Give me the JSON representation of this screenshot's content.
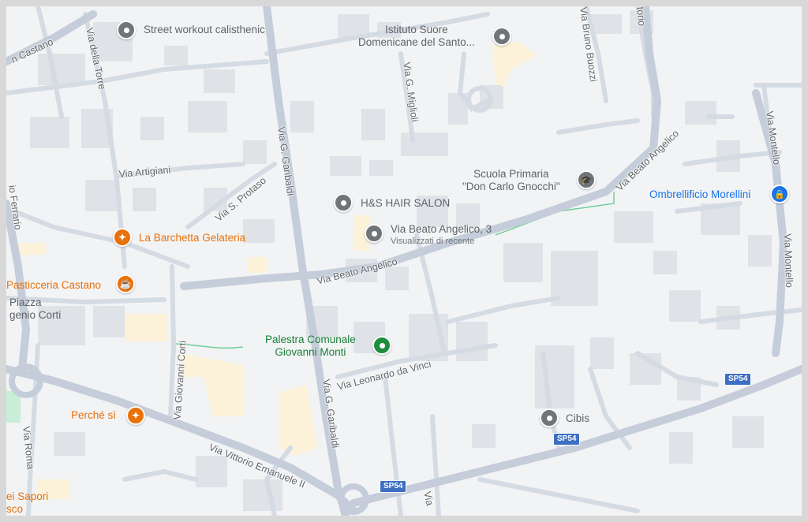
{
  "map": {
    "colors": {
      "background": "#f2f3f5",
      "block": "#dfe2e7",
      "road_major": "#c4cdd9",
      "road_minor": "#d5dbe3",
      "highlight_building": "#fbf2d9",
      "green": "#6fcf97",
      "poi_gray": "#70757a",
      "poi_orange": "#e8710a",
      "poi_green": "#1e8e3e",
      "poi_blue": "#1a73e8",
      "route_shield": "#3d6fc2"
    },
    "pois": [
      {
        "id": "street-workout",
        "name": "Street workout calisthenic",
        "category": "gray",
        "icon": "pin-icon"
      },
      {
        "id": "istituto-suore",
        "name": "Istituto Suore\nDomenicane del Santo...",
        "category": "gray",
        "icon": "pin-icon"
      },
      {
        "id": "hs-hair-salon",
        "name": "H&S HAIR SALON",
        "category": "gray",
        "icon": "pin-icon"
      },
      {
        "id": "via-beato-angelico-3",
        "name": "Via Beato Angelico, 3",
        "subtitle": "Visualizzati di recente",
        "category": "gray",
        "icon": "pin-icon"
      },
      {
        "id": "scuola-primaria",
        "name": "Scuola Primaria\n\"Don Carlo Gnocchi\"",
        "category": "gray",
        "icon": "school-icon"
      },
      {
        "id": "ombrellificio",
        "name": "Ombrellificio Morellini",
        "category": "blue",
        "icon": "shopping-bag-icon"
      },
      {
        "id": "la-barchetta",
        "name": "La Barchetta Gelateria",
        "category": "orange",
        "icon": "restaurant-icon"
      },
      {
        "id": "pasticceria",
        "name": "Pasticceria Castano",
        "category": "orange",
        "icon": "coffee-icon"
      },
      {
        "id": "palestra",
        "name": "Palestra Comunale\nGiovanni Monti",
        "category": "green",
        "icon": "park-icon"
      },
      {
        "id": "perche-si",
        "name": "Perché sì",
        "category": "orange",
        "icon": "restaurant-icon"
      },
      {
        "id": "cibis",
        "name": "Cibis",
        "category": "gray",
        "icon": "pin-icon"
      }
    ],
    "streets": [
      {
        "id": "castano",
        "name": "n Castano"
      },
      {
        "id": "via-della-torre",
        "name": "Via della Torre"
      },
      {
        "id": "via-artigiani",
        "name": "Via Artigiani"
      },
      {
        "id": "via-s-protaso",
        "name": "Via S. Protaso"
      },
      {
        "id": "via-g-garibaldi-1",
        "name": "Via G. Garibaldi"
      },
      {
        "id": "via-g-garibaldi-2",
        "name": "Via G. Garibaldi"
      },
      {
        "id": "via-g-miglioli",
        "name": "Via G. Miglioli"
      },
      {
        "id": "via-bruno-buozzi",
        "name": "Via Bruno Buozzi"
      },
      {
        "id": "via-beato-angelico-1",
        "name": "Via Beato Angelico"
      },
      {
        "id": "via-beato-angelico-2",
        "name": "Via Beato Angelico"
      },
      {
        "id": "via-montello-1",
        "name": "Via Montello"
      },
      {
        "id": "via-montello-2",
        "name": "Via Montello"
      },
      {
        "id": "ferrario",
        "name": "io Ferrario"
      },
      {
        "id": "piazza",
        "name": "Piazza\ngenio Corti"
      },
      {
        "id": "via-giovanni-corti",
        "name": "Via Giovanni Corti"
      },
      {
        "id": "via-leonardo-da-vinci",
        "name": "Via Leonardo da Vinci"
      },
      {
        "id": "via-vittorio-emanuele",
        "name": "Via Vittorio Emanuele II"
      },
      {
        "id": "via-roma",
        "name": "Via Roma"
      },
      {
        "id": "sapori",
        "name": "ei Sapori\nsco"
      },
      {
        "id": "torio",
        "name": "torio"
      },
      {
        "id": "via-bottom",
        "name": "Via"
      }
    ],
    "route_shields": [
      "SP54",
      "SP54",
      "SP54"
    ]
  }
}
